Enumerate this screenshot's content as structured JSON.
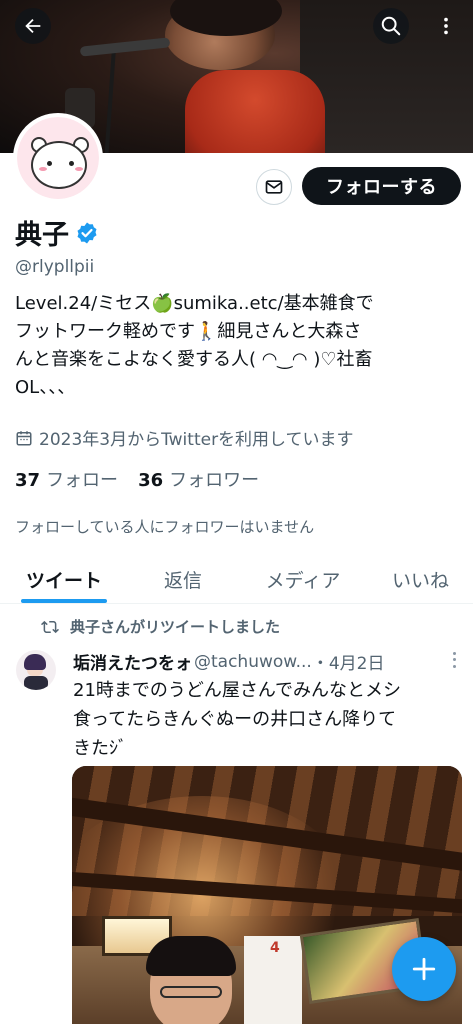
{
  "profile": {
    "display_name": "典子",
    "handle": "@rlypllpii",
    "bio_lines": [
      "Level.24/ミセス🍏sumika..etc/基本雑食で",
      "フットワーク軽めです🚶細見さんと大森さ",
      "んと音楽をこよなく愛する人( ◠‿◠ )♡社畜",
      "OL、、、"
    ],
    "joined": "2023年3月からTwitterを利用しています",
    "following_count": "37",
    "following_label": "フォロー",
    "followers_count": "36",
    "followers_label": "フォロワー",
    "followers_note": "フォローしている人にフォロワーはいません",
    "follow_button": "フォローする",
    "verified": true
  },
  "tabs": [
    {
      "label": "ツイート",
      "active": true
    },
    {
      "label": "返信",
      "active": false
    },
    {
      "label": "メディア",
      "active": false
    },
    {
      "label": "いいね",
      "active": false
    }
  ],
  "tweet": {
    "retweet_note": "典子さんがリツイートしました",
    "author": "垢消えたつをォ",
    "author_handle": "@tachuwow...",
    "date": "・4月2日",
    "text_lines": [
      "21時までのうどん屋さんでみんなとメシ",
      "食ってたらきんぐぬーの井口さん降りて",
      "きたｼﾞ"
    ],
    "photo_calendar_month": "4"
  },
  "icons": {
    "back": "arrow-left-icon",
    "search": "search-icon",
    "more": "more-vertical-icon",
    "mail": "mail-icon",
    "verified": "verified-badge-icon",
    "calendar": "calendar-icon",
    "retweet": "retweet-icon",
    "compose": "plus-icon"
  },
  "colors": {
    "accent": "#1d9bf0",
    "text": "#0f1419",
    "secondary_text": "#536471",
    "follow_button_bg": "#0f1419"
  }
}
